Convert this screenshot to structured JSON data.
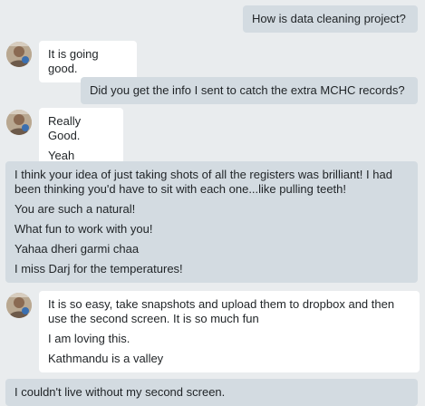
{
  "messages": [
    {
      "side": "out",
      "lines": [
        "How is data cleaning project?"
      ]
    },
    {
      "side": "in",
      "lines": [
        "It is going good."
      ]
    },
    {
      "side": "out",
      "lines": [
        "Did you get the info I sent to catch the extra MCHC records?"
      ]
    },
    {
      "side": "in",
      "lines": [
        "Really Good.",
        "Yeah"
      ]
    },
    {
      "side": "out",
      "lines": [
        "I think your idea of just taking shots of all the registers was brilliant! I had been thinking you'd have to sit with each one...like pulling teeth!",
        "You are such a natural!",
        "What fun to work with you!",
        "Yahaa dheri garmi chaa",
        "I miss Darj for the temperatures!"
      ]
    },
    {
      "side": "in",
      "lines": [
        "It is so easy, take snapshots and upload them to dropbox and then use the second screen. It is so much fun",
        "I am loving this.",
        "Kathmandu is a valley"
      ]
    },
    {
      "side": "out",
      "lines": [
        "I couldn't live without my second screen."
      ]
    }
  ],
  "colors": {
    "background": "#e9ecee",
    "outgoing_bubble": "#d3dbe1",
    "incoming_bubble": "#ffffff"
  },
  "icons": {
    "avatar": "contact-avatar-icon"
  }
}
